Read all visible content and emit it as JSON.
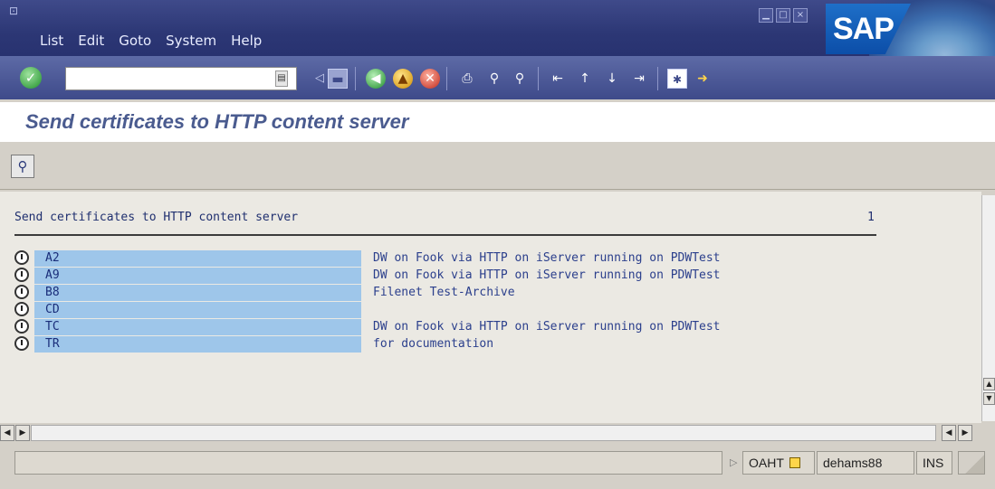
{
  "window": {
    "menu": [
      "List",
      "Edit",
      "Goto",
      "System",
      "Help"
    ],
    "logo_text": "SAP"
  },
  "toolbar": {
    "command_field_value": "",
    "icons": [
      "ok-icon",
      "history-icon",
      "back-icon",
      "save-icon",
      "green-arrow-icon",
      "exit-icon",
      "cancel-icon",
      "print-icon",
      "find-icon",
      "find-next-icon",
      "first-page-icon",
      "previous-page-icon",
      "next-page-icon",
      "last-page-icon",
      "new-session-icon",
      "shortcut-icon"
    ]
  },
  "page": {
    "title": "Send certificates to HTTP content server"
  },
  "app_toolbar": {
    "icons": [
      "detail-icon"
    ]
  },
  "list": {
    "header": "Send certificates to HTTP content server",
    "page_number": "1",
    "rows": [
      {
        "code": "A2",
        "description": "DW on Fook via HTTP on iServer running on PDWTest"
      },
      {
        "code": "A9",
        "description": "DW on Fook via HTTP on iServer running on PDWTest"
      },
      {
        "code": "B8",
        "description": "Filenet Test-Archive"
      },
      {
        "code": "CD",
        "description": ""
      },
      {
        "code": "TC",
        "description": "DW on Fook via HTTP on iServer running on PDWTest"
      },
      {
        "code": "TR",
        "description": "for documentation"
      }
    ]
  },
  "statusbar": {
    "message": "",
    "system": "OAHT",
    "server": "dehams88",
    "mode": "INS"
  }
}
